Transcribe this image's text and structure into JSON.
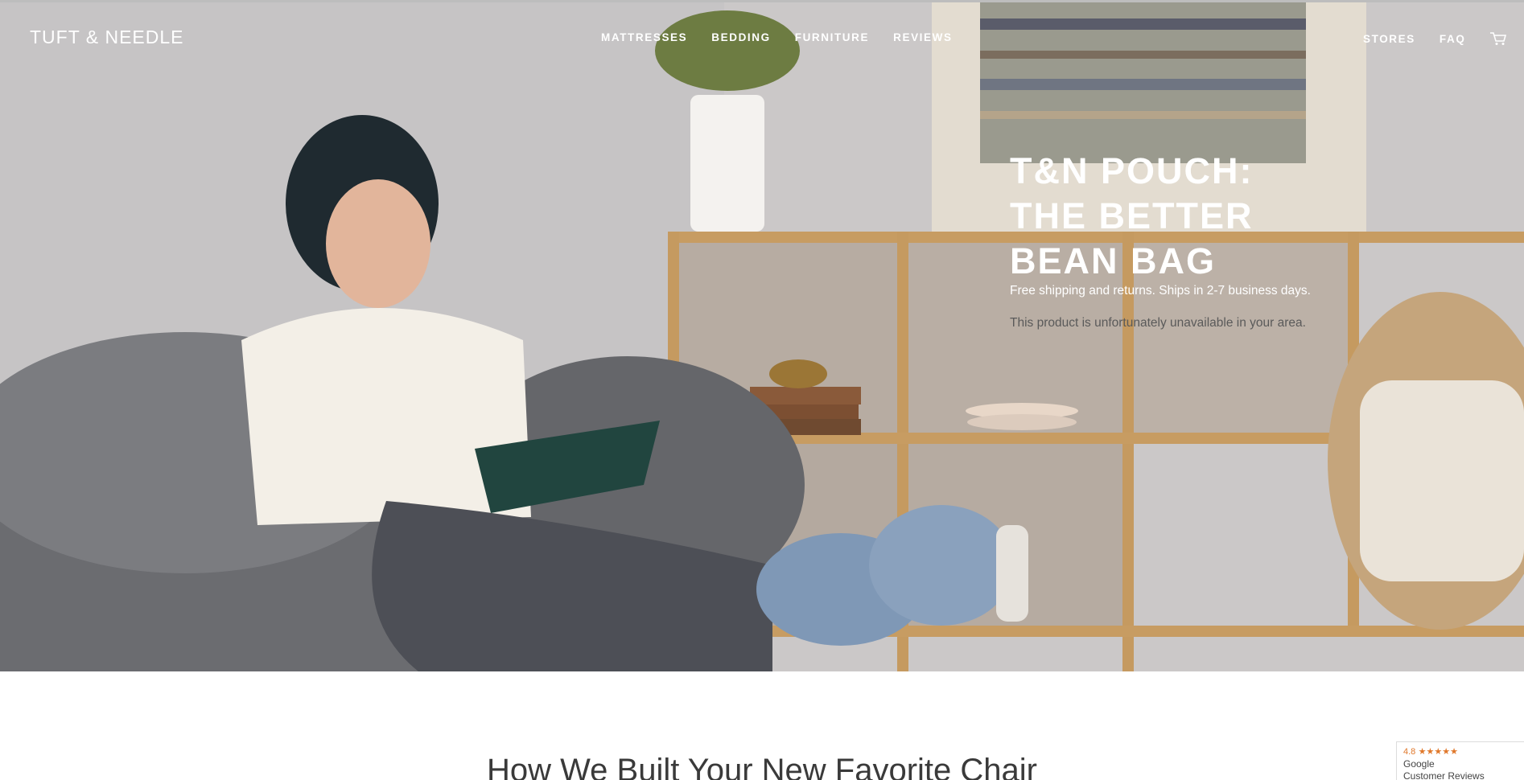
{
  "brand": {
    "logo_text": "TUFT & NEEDLE"
  },
  "nav": {
    "main": [
      "MATTRESSES",
      "BEDDING",
      "FURNITURE",
      "REVIEWS"
    ],
    "right": [
      "STORES",
      "FAQ"
    ],
    "cart_icon": "cart-icon"
  },
  "hero": {
    "headline": [
      "T&N POUCH:",
      "THE BETTER",
      "BEAN BAG"
    ],
    "subline": "Free shipping and returns. Ships in 2-7 business days.",
    "availability": "This product is unfortunately unavailable in your area."
  },
  "section": {
    "title": "How We Built Your New Favorite Chair"
  },
  "reviews_badge": {
    "rating": "4.8",
    "stars": "★★★★★",
    "line1": "Google",
    "line2": "Customer Reviews"
  },
  "colors": {
    "wall": "#c9c6c6",
    "shelf": "#c99c62",
    "beanbag": "#6e6f73",
    "slippers": "#7f98b6"
  }
}
